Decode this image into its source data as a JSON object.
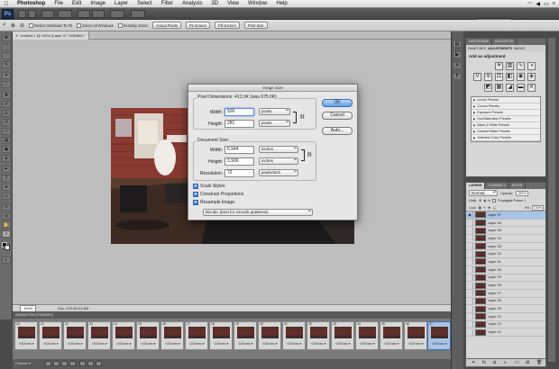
{
  "menubar": {
    "apple": "",
    "items": [
      "Photoshop",
      "File",
      "Edit",
      "Image",
      "Layer",
      "Select",
      "Filter",
      "Analysis",
      "3D",
      "View",
      "Window",
      "Help"
    ]
  },
  "appbar": {
    "logo": "Ps",
    "workspace": "ESSENTIALS ▾",
    "cs_live": "CS Live ▾"
  },
  "options": {
    "tool": "zoom",
    "resize_windows": "Resize Windows To Fit",
    "zoom_all": "Zoom All Windows",
    "scrubby": "Scrubby Zoom",
    "actual_pixels": "Actual Pixels",
    "fit_screen": "Fit Screen",
    "fill_screen": "Fill Screen",
    "print_size": "Print Size"
  },
  "document": {
    "tab_title": "Untitled-1 @ 100% (Layer 37, RGB/8#) *",
    "zoom": "100%",
    "doc_info": "Doc: 675.0K/24.6M"
  },
  "dialog": {
    "title": "Image Size",
    "pixel_dimensions_label": "Pixel Dimensions:",
    "pixel_dimensions_value": "412.0K (was 675.0K)",
    "width_label": "Width:",
    "width_value": "500",
    "width_unit": "pixels",
    "height_label": "Height:",
    "height_value": "281",
    "height_unit": "pixels",
    "document_size_label": "Document Size:",
    "doc_width_label": "Width:",
    "doc_width_value": "6.944",
    "doc_width_unit": "inches",
    "doc_height_label": "Height:",
    "doc_height_value": "3.906",
    "doc_height_unit": "inches",
    "resolution_label": "Resolution:",
    "resolution_value": "72",
    "resolution_unit": "pixels/inch",
    "scale_styles": "Scale Styles",
    "constrain": "Constrain Proportions",
    "resample": "Resample Image:",
    "resample_method": "Bicubic (best for smooth gradients)",
    "ok": "OK",
    "cancel": "Cancel",
    "auto": "Auto..."
  },
  "adjustments": {
    "tabs": [
      "HISTOGRAM",
      "NAVIGATOR"
    ],
    "active_tab": "ADJUSTMENTS",
    "other_tab": "MASKS",
    "sub_tab": "SWATCHES",
    "heading": "Add an adjustment",
    "presets": [
      "Levels Presets",
      "Curves Presets",
      "Exposure Presets",
      "Hue/Saturation Presets",
      "Black & White Presets",
      "Channel Mixer Presets",
      "Selective Color Presets"
    ]
  },
  "layers": {
    "tabs": [
      "LAYERS",
      "CHANNELS",
      "PATHS"
    ],
    "blend_mode": "Normal",
    "opacity_label": "Opacity:",
    "opacity_value": "100%",
    "unify_label": "Unify:",
    "propagate": "Propagate Frame 1",
    "lock_label": "Lock:",
    "fill_label": "Fill:",
    "fill_value": "100%",
    "rows": [
      "Layer 37",
      "Layer 36",
      "Layer 35",
      "Layer 34",
      "Layer 33",
      "Layer 32",
      "Layer 31",
      "Layer 30",
      "Layer 29",
      "Layer 28",
      "Layer 27",
      "Layer 26",
      "Layer 25",
      "Layer 24",
      "Layer 23",
      "Layer 22"
    ]
  },
  "animation": {
    "header": "ANIMATION (FRAMES)",
    "frames": [
      "20",
      "21",
      "22",
      "23",
      "24",
      "25",
      "26",
      "27",
      "28",
      "29",
      "30",
      "31",
      "32",
      "33",
      "34",
      "35",
      "36",
      "37"
    ],
    "duration": "0.03 sec.▾",
    "loop": "Forever ▾"
  }
}
